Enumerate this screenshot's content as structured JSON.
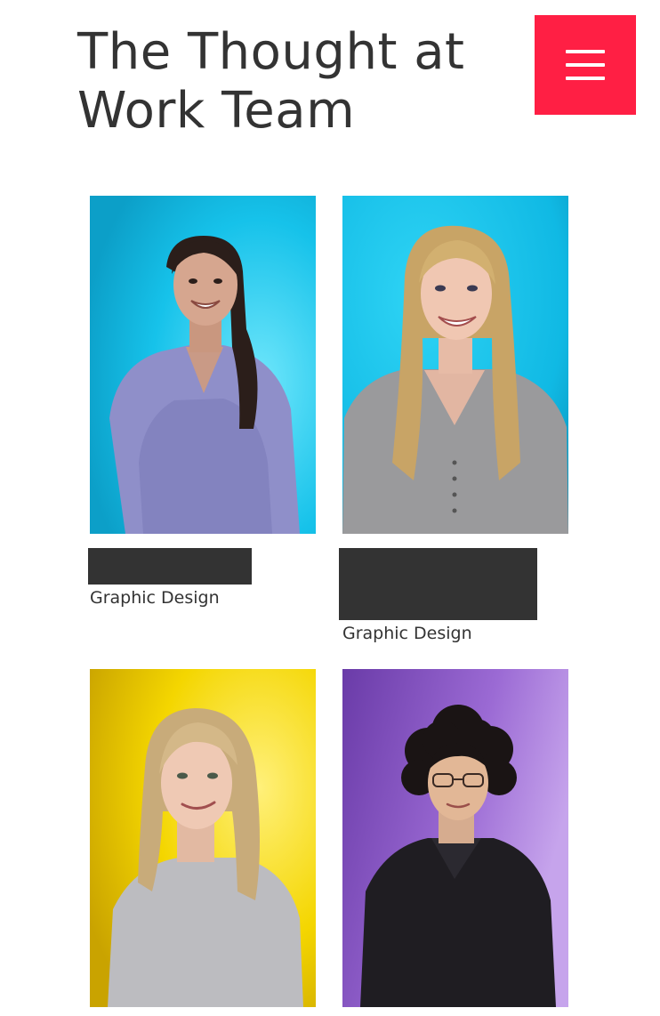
{
  "header": {
    "title": "The Thought at Work Team",
    "menu_icon": "hamburger-menu-icon",
    "menu_color": "#ff1f44"
  },
  "team": [
    {
      "role": "Graphic Design",
      "photo_background": "#15c4ea",
      "portrait": "woman smiling, dark ponytail, lavender long-sleeve top"
    },
    {
      "role": "Graphic Design",
      "photo_background": "#12c8f0",
      "portrait": "woman smiling, long blonde hair, grey henley top"
    },
    {
      "photo_background": "#f3d300",
      "portrait": "woman smiling, blonde hair, light grey t-shirt"
    },
    {
      "photo_background": "#9d6bd6",
      "portrait": "person with curly dark hair and glasses, black jacket"
    }
  ],
  "colors": {
    "text": "#333333",
    "redaction": "#333333",
    "accent": "#ff1f44"
  }
}
